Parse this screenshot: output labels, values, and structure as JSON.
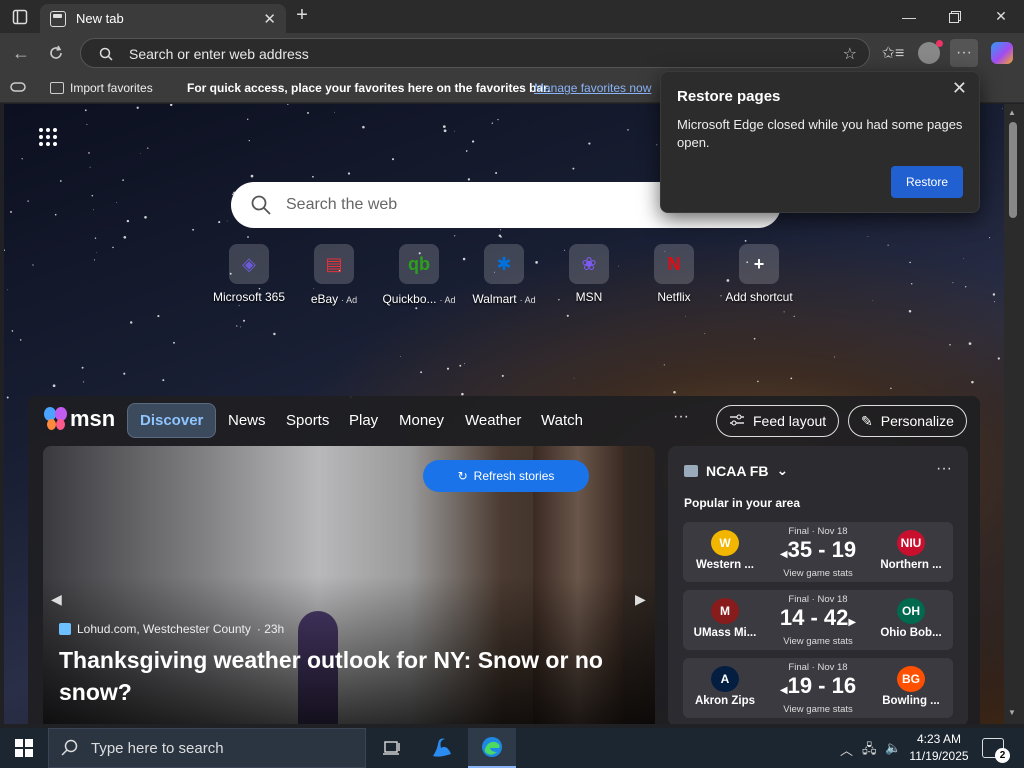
{
  "browser": {
    "tab_title": "New tab",
    "address_placeholder": "Search or enter web address"
  },
  "favorites_bar": {
    "import_label": "Import favorites",
    "message": "For quick access, place your favorites here on the favorites bar.",
    "manage_link": "Manage favorites now"
  },
  "restore_popup": {
    "title": "Restore pages",
    "message": "Microsoft Edge closed while you had some pages open.",
    "button": "Restore"
  },
  "newtab": {
    "search_placeholder": "Search the web",
    "shortcuts": [
      {
        "label": "Microsoft 365",
        "ad": "",
        "icon": "microsoft365-icon",
        "color": "#6b5bd6"
      },
      {
        "label": "eBay",
        "ad": "· Ad",
        "icon": "ebay-icon",
        "color": "#e53238"
      },
      {
        "label": "Quickbo...",
        "ad": "· Ad",
        "icon": "quickbooks-icon",
        "color": "#2ca01c"
      },
      {
        "label": "Walmart",
        "ad": "· Ad",
        "icon": "walmart-icon",
        "color": "#0071dc"
      },
      {
        "label": "MSN",
        "ad": "",
        "icon": "msn-icon",
        "color": "#7d5bf0"
      },
      {
        "label": "Netflix",
        "ad": "",
        "icon": "netflix-icon",
        "color": "#e50914"
      },
      {
        "label": "Add shortcut",
        "ad": "",
        "icon": "plus-icon",
        "color": "#ffffff"
      }
    ]
  },
  "feed": {
    "logo_text": "msn",
    "tabs": [
      "Discover",
      "News",
      "Sports",
      "Play",
      "Money",
      "Weather",
      "Watch"
    ],
    "more": "···",
    "feed_layout_label": "Feed layout",
    "personalize_label": "Personalize",
    "refresh_label": "Refresh stories",
    "hero": {
      "source": "Lohud.com, Westchester County",
      "age": "· 23h",
      "title": "Thanksgiving weather outlook for NY: Snow or no snow?"
    }
  },
  "sports": {
    "league": "NCAA FB",
    "subtitle": "Popular in your area",
    "games": [
      {
        "status": "Final · Nov 18",
        "score": "35 - 19",
        "winner": "left",
        "stats": "View game stats",
        "left": {
          "name": "Western ...",
          "logo": "W",
          "color": "#f2b600"
        },
        "right": {
          "name": "Northern ...",
          "logo": "NIU",
          "color": "#c8102e"
        }
      },
      {
        "status": "Final · Nov 18",
        "score": "14 - 42",
        "winner": "right",
        "stats": "View game stats",
        "left": {
          "name": "UMass Mi...",
          "logo": "M",
          "color": "#881c1c"
        },
        "right": {
          "name": "Ohio Bob...",
          "logo": "OH",
          "color": "#00694e"
        }
      },
      {
        "status": "Final · Nov 18",
        "score": "19 - 16",
        "winner": "left",
        "stats": "View game stats",
        "left": {
          "name": "Akron Zips",
          "logo": "A",
          "color": "#041e42"
        },
        "right": {
          "name": "Bowling ...",
          "logo": "BG",
          "color": "#fe5000"
        }
      }
    ]
  },
  "taskbar": {
    "search_placeholder": "Type here to search",
    "time": "4:23 AM",
    "date": "11/19/2025",
    "notification_count": "2"
  },
  "colors": {
    "accent": "#2060d0",
    "link": "#8ab4f8",
    "discover_active": "#8ec5ff"
  }
}
